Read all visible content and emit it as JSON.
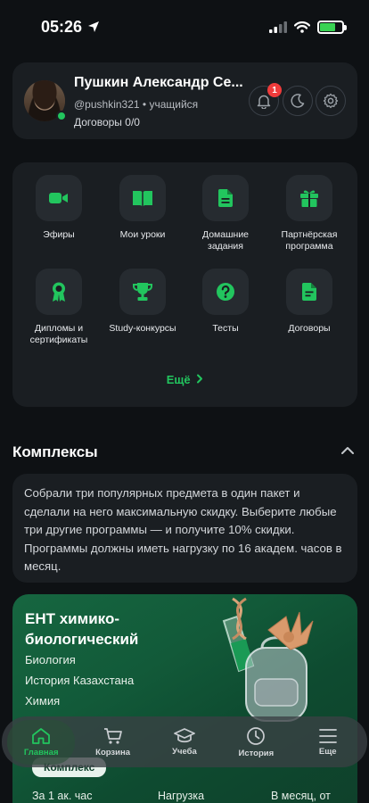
{
  "status_bar": {
    "time": "05:26"
  },
  "profile": {
    "name": "Пушкин Александр Се...",
    "username": "@pushkin321",
    "separator": "•",
    "role": "учащийся",
    "contracts": "Договоры 0/0",
    "notifications_count": "1"
  },
  "menu": {
    "items": [
      {
        "label": "Эфиры",
        "icon": "video-camera-icon"
      },
      {
        "label": "Мои уроки",
        "icon": "book-icon"
      },
      {
        "label": "Домашние задания",
        "icon": "document-icon"
      },
      {
        "label": "Партнёрская программа",
        "icon": "gift-icon"
      },
      {
        "label": "Дипломы и сертификаты",
        "icon": "award-icon"
      },
      {
        "label": "Study-конкурсы",
        "icon": "trophy-icon"
      },
      {
        "label": "Тесты",
        "icon": "question-icon"
      },
      {
        "label": "Договоры",
        "icon": "contract-icon"
      }
    ],
    "more_label": "Ещё"
  },
  "complexes": {
    "title": "Комплексы",
    "description": "Собрали три популярных предмета в один пакет и сделали на него максимальную скидку. Выберите любые три другие программы — и получите 10% скидки. Программы должны иметь нагрузку по 16 академ. часов в месяц.",
    "bundle": {
      "title": "ЕНТ химико-биологический",
      "subjects": [
        "Биология",
        "История Казахстана",
        "Химия"
      ],
      "tag": "Комплекс",
      "price_hour_label": "За 1 ак. час",
      "load_label": "Нагрузка",
      "month_label": "В месяц, от"
    }
  },
  "tab_bar": {
    "tabs": [
      {
        "label": "Главная",
        "active": true
      },
      {
        "label": "Корзина",
        "active": false
      },
      {
        "label": "Учеба",
        "active": false
      },
      {
        "label": "История",
        "active": false
      },
      {
        "label": "Еще",
        "active": false
      }
    ]
  },
  "colors": {
    "accent": "#22c55e",
    "card": "#1a1e22",
    "background": "#0e1114",
    "badge": "#ef3b3b"
  }
}
